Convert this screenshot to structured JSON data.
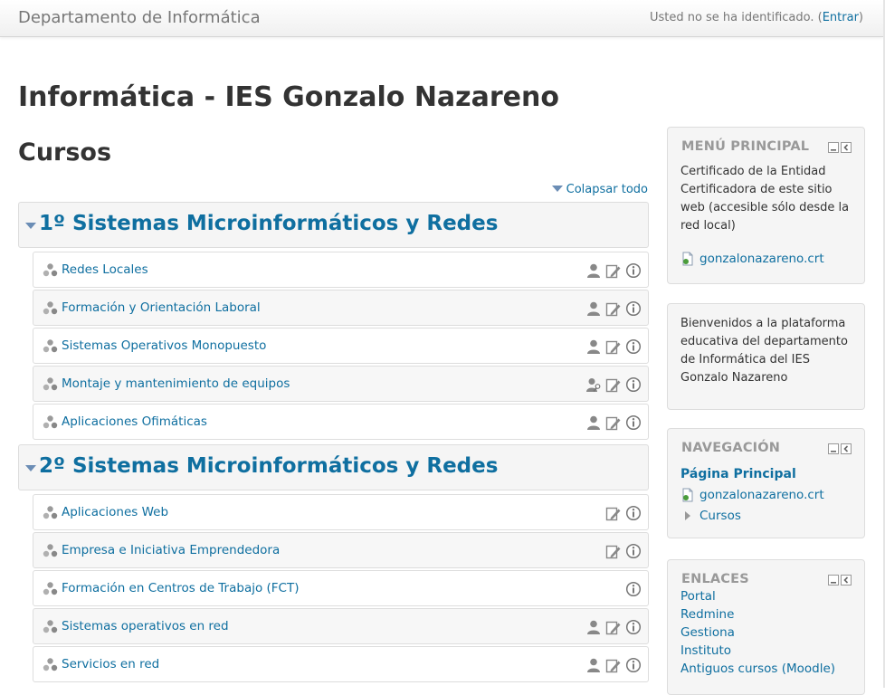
{
  "header": {
    "brand": "Departamento de Informática",
    "login_text": "Usted no se ha identificado. (",
    "login_link": "Entrar",
    "login_close": ")"
  },
  "site_title": "Informática - IES Gonzalo Nazareno",
  "section_heading": "Cursos",
  "collapse_all": "Colapsar todo",
  "categories": [
    {
      "name": "1º Sistemas Microinformáticos y Redes",
      "courses": [
        {
          "name": "Redes Locales",
          "icons": [
            "guest-access-icon",
            "self-enrol-icon",
            "summary-info-icon"
          ]
        },
        {
          "name": "Formación y Orientación Laboral",
          "icons": [
            "guest-access-icon",
            "self-enrol-icon",
            "summary-info-icon"
          ]
        },
        {
          "name": "Sistemas Operativos Monopuesto",
          "icons": [
            "guest-access-icon",
            "self-enrol-icon",
            "summary-info-icon"
          ]
        },
        {
          "name": "Montaje y mantenimiento de equipos",
          "icons": [
            "guest-key-icon",
            "self-enrol-icon",
            "summary-info-icon"
          ]
        },
        {
          "name": "Aplicaciones Ofimáticas",
          "icons": [
            "guest-access-icon",
            "self-enrol-icon",
            "summary-info-icon"
          ]
        }
      ]
    },
    {
      "name": "2º Sistemas Microinformáticos y Redes",
      "courses": [
        {
          "name": "Aplicaciones Web",
          "icons": [
            "self-enrol-icon",
            "summary-info-icon"
          ]
        },
        {
          "name": "Empresa e Iniciativa Emprendedora",
          "icons": [
            "self-enrol-icon",
            "summary-info-icon"
          ]
        },
        {
          "name": "Formación en Centros de Trabajo (FCT)",
          "icons": [
            "summary-info-icon"
          ]
        },
        {
          "name": "Sistemas operativos en red",
          "icons": [
            "guest-access-icon",
            "self-enrol-icon",
            "summary-info-icon"
          ]
        },
        {
          "name": "Servicios en red",
          "icons": [
            "guest-access-icon",
            "self-enrol-icon",
            "summary-info-icon"
          ]
        }
      ]
    }
  ],
  "blocks": {
    "main_menu": {
      "title": "MENÚ PRINCIPAL",
      "text": "Certificado de la Entidad Certificadora de este sitio web (accesible sólo desde la red local)",
      "file_link": "gonzalonazareno.crt"
    },
    "welcome": {
      "text": "Bienvenidos a la plataforma educativa del departamento de Informática del IES Gonzalo Nazareno"
    },
    "navigation": {
      "title": "NAVEGACIÓN",
      "home": "Página Principal",
      "file_link": "gonzalonazareno.crt",
      "courses": "Cursos"
    },
    "links": {
      "title": "ENLACES",
      "items": [
        "Portal",
        "Redmine",
        "Gestiona",
        "Instituto",
        "Antiguos cursos (Moodle)"
      ]
    }
  },
  "colors": {
    "link": "#0f6fa0",
    "heading": "#333333",
    "block_title": "#999999",
    "block_bg": "#f5f5f5"
  }
}
